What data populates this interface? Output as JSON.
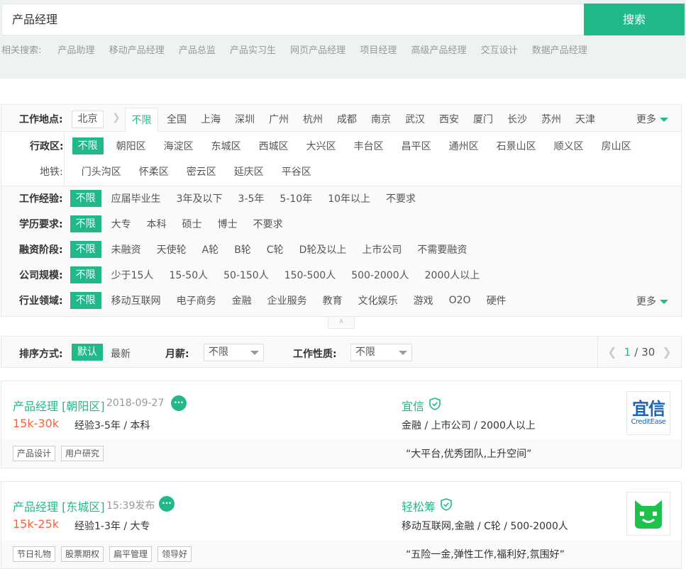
{
  "search": {
    "query": "产品经理",
    "button": "搜索"
  },
  "related": {
    "label": "相关搜索:",
    "items": [
      "产品助理",
      "移动产品经理",
      "产品总监",
      "产品实习生",
      "网页产品经理",
      "项目经理",
      "高级产品经理",
      "交互设计",
      "数据产品经理"
    ]
  },
  "location": {
    "label": "工作地点:",
    "current": "北京",
    "unlimited": "不限",
    "cities": [
      "全国",
      "上海",
      "深圳",
      "广州",
      "杭州",
      "成都",
      "南京",
      "武汉",
      "西安",
      "厦门",
      "长沙",
      "苏州",
      "天津"
    ],
    "more": "更多"
  },
  "district": {
    "label": "行政区:",
    "unlimited": "不限",
    "items": [
      "朝阳区",
      "海淀区",
      "东城区",
      "西城区",
      "大兴区",
      "丰台区",
      "昌平区",
      "通州区",
      "石景山区",
      "顺义区",
      "房山区"
    ],
    "items2": [
      "门头沟区",
      "怀柔区",
      "密云区",
      "延庆区",
      "平谷区"
    ],
    "subway_label": "地铁:"
  },
  "filters": [
    {
      "label": "工作经验:",
      "unlimited": "不限",
      "options": [
        "应届毕业生",
        "3年及以下",
        "3-5年",
        "5-10年",
        "10年以上",
        "不要求"
      ]
    },
    {
      "label": "学历要求:",
      "unlimited": "不限",
      "options": [
        "大专",
        "本科",
        "硕士",
        "博士",
        "不要求"
      ]
    },
    {
      "label": "融资阶段:",
      "unlimited": "不限",
      "options": [
        "未融资",
        "天使轮",
        "A轮",
        "B轮",
        "C轮",
        "D轮及以上",
        "上市公司",
        "不需要融资"
      ]
    },
    {
      "label": "公司规模:",
      "unlimited": "不限",
      "options": [
        "少于15人",
        "15-50人",
        "50-150人",
        "150-500人",
        "500-2000人",
        "2000人以上"
      ]
    },
    {
      "label": "行业领域:",
      "unlimited": "不限",
      "options": [
        "移动互联网",
        "电子商务",
        "金融",
        "企业服务",
        "教育",
        "文化娱乐",
        "游戏",
        "O2O",
        "硬件"
      ],
      "more": "更多"
    }
  ],
  "sort": {
    "label": "排序方式:",
    "default": "默认",
    "latest": "最新",
    "salary_label": "月薪:",
    "salary_value": "不限",
    "nature_label": "工作性质:",
    "nature_value": "不限",
    "page_current": "1",
    "page_sep": "/",
    "page_total": "30"
  },
  "jobs": [
    {
      "title": "产品经理 [朝阳区]",
      "published": "2018-09-27",
      "salary": "15k-30k",
      "requirement": "经验3-5年 / 本科",
      "company": "宜信",
      "industry": "金融 / 上市公司 / 2000人以上",
      "tags": [
        "产品设计",
        "用户研究"
      ],
      "quote": "“大平台,优秀团队,上升空间”",
      "logo_text": "宜信",
      "logo_sub": "CreditEase"
    },
    {
      "title": "产品经理 [东城区]",
      "published": "15:39发布",
      "salary": "15k-25k",
      "requirement": "经验1-3年 / 大专",
      "company": "轻松筹",
      "industry": "移动互联网,金融 / C轮 / 500-2000人",
      "tags": [
        "节日礼物",
        "股票期权",
        "扁平管理",
        "领导好"
      ],
      "quote": "“五险一金,弹性工作,福利好,氛围好”"
    }
  ],
  "colors": {
    "accent": "#21b98a",
    "salary": "#fd5f39"
  }
}
